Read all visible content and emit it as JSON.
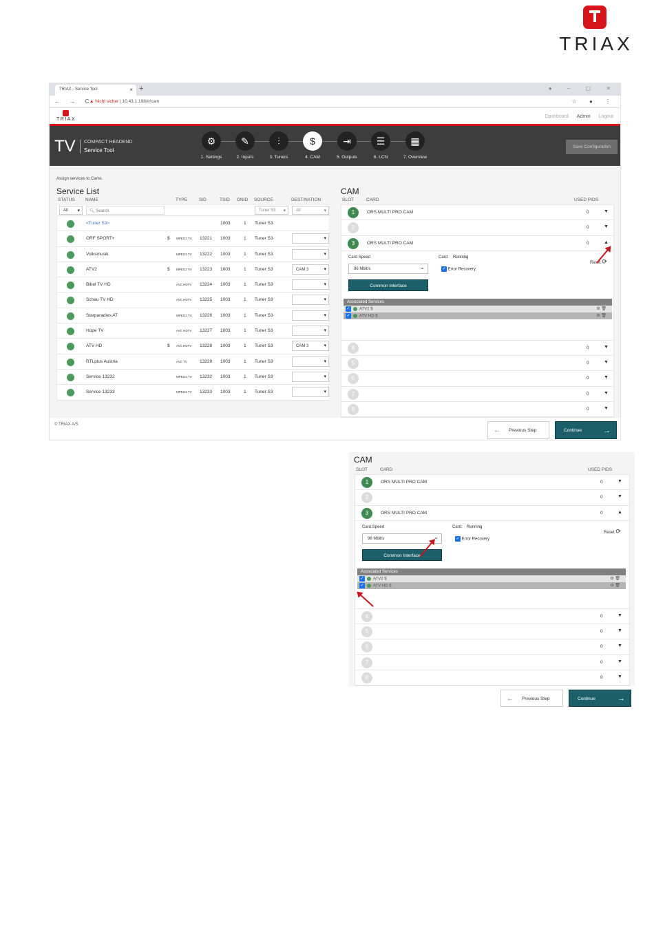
{
  "logo": {
    "word": "TRIAX"
  },
  "browser": {
    "tab_title": "TRIAX - Service Tool",
    "insecure_label": "Nicht sicher",
    "url": "10.43.1.198/#/cam"
  },
  "app": {
    "logo_word": "TRIAX",
    "nav": {
      "dashboard": "Dashboard",
      "admin": "Admin",
      "logout": "Logout"
    },
    "tv": "TV",
    "subtitle1": "COMPACT HEADEND",
    "subtitle2": "Service Tool",
    "steps": [
      {
        "label": "1. Settings",
        "icon": "gear-icon"
      },
      {
        "label": "2. Inputs",
        "icon": "plug-icon"
      },
      {
        "label": "3. Tuners",
        "icon": "sliders-icon"
      },
      {
        "label": "4. CAM",
        "icon": "cam-card-icon"
      },
      {
        "label": "5. Outputs",
        "icon": "output-icon"
      },
      {
        "label": "6. LCN",
        "icon": "list-icon"
      },
      {
        "label": "7. Overview",
        "icon": "grid-icon"
      }
    ],
    "save_config": "Save Configuration",
    "assign_text": "Assign services to Cams.",
    "service_list": {
      "title": "Service List",
      "headers": {
        "status": "STATUS",
        "name": "NAME",
        "type": "TYPE",
        "sid": "SID",
        "tsid": "TSID",
        "onid": "ONID",
        "source": "SOURCE",
        "destination": "DESTINATION"
      },
      "filter": {
        "status": "All",
        "search_placeholder": "Search",
        "source": "Tuner S3",
        "destination": "All"
      },
      "rows": [
        {
          "name": "<Tuner S3>",
          "dollar": "",
          "type": "",
          "sid": "",
          "tsid": "1003",
          "onid": "1",
          "source": "Tuner S3",
          "dest": null
        },
        {
          "name": "ORF SPORT+",
          "dollar": "$",
          "type": "MPEG2 TV",
          "sid": "13221",
          "tsid": "1003",
          "onid": "1",
          "source": "Tuner S3",
          "dest": ""
        },
        {
          "name": "Volksmusik",
          "dollar": "",
          "type": "MPEG2 TV",
          "sid": "13222",
          "tsid": "1003",
          "onid": "1",
          "source": "Tuner S3",
          "dest": ""
        },
        {
          "name": "ATV2",
          "dollar": "$",
          "type": "MPEG2 TV",
          "sid": "13223",
          "tsid": "1003",
          "onid": "1",
          "source": "Tuner S3",
          "dest": "CAM 3"
        },
        {
          "name": "Bibel TV HD",
          "dollar": "",
          "type": "AVC HDTV",
          "sid": "13224",
          "tsid": "1003",
          "onid": "1",
          "source": "Tuner S3",
          "dest": ""
        },
        {
          "name": "Schau TV HD",
          "dollar": "",
          "type": "AVC HDTV",
          "sid": "13225",
          "tsid": "1003",
          "onid": "1",
          "source": "Tuner S3",
          "dest": ""
        },
        {
          "name": "Starparadies AT",
          "dollar": "",
          "type": "MPEG2 TV",
          "sid": "13226",
          "tsid": "1003",
          "onid": "1",
          "source": "Tuner S3",
          "dest": ""
        },
        {
          "name": "Hope TV",
          "dollar": "",
          "type": "AVC HDTV",
          "sid": "13227",
          "tsid": "1003",
          "onid": "1",
          "source": "Tuner S3",
          "dest": ""
        },
        {
          "name": "ATV HD",
          "dollar": "$",
          "type": "AVC HDTV",
          "sid": "13228",
          "tsid": "1003",
          "onid": "1",
          "source": "Tuner S3",
          "dest": "CAM 3"
        },
        {
          "name": "RTLplus Austria",
          "dollar": "",
          "type": "AVC TV",
          "sid": "13229",
          "tsid": "1003",
          "onid": "1",
          "source": "Tuner S3",
          "dest": ""
        },
        {
          "name": "Service 13232",
          "dollar": "",
          "type": "MPEG2 TV",
          "sid": "13232",
          "tsid": "1003",
          "onid": "1",
          "source": "Tuner S3",
          "dest": ""
        },
        {
          "name": "Service 13233",
          "dollar": "",
          "type": "MPEG2 TV",
          "sid": "13233",
          "tsid": "1003",
          "onid": "1",
          "source": "Tuner S3",
          "dest": ""
        }
      ]
    },
    "cam": {
      "title": "CAM",
      "headers": {
        "slot": "SLOT",
        "card": "CARD",
        "used_pids": "USED PIDS"
      },
      "slots": [
        {
          "num": "1",
          "card": "ORS MULTI PRO CAM",
          "pids": "0",
          "active": true
        },
        {
          "num": "2",
          "card": "",
          "pids": "0",
          "active": false
        },
        {
          "num": "3",
          "card": "ORS MULTI PRO CAM",
          "pids": "0",
          "active": true
        },
        {
          "num": "4",
          "card": "",
          "pids": "0",
          "active": false
        },
        {
          "num": "5",
          "card": "",
          "pids": "0",
          "active": false
        },
        {
          "num": "6",
          "card": "",
          "pids": "0",
          "active": false
        },
        {
          "num": "7",
          "card": "",
          "pids": "0",
          "active": false
        },
        {
          "num": "8",
          "card": "",
          "pids": "0",
          "active": false
        }
      ],
      "expanded": {
        "card_speed_label": "Card Speed",
        "card_label": "Card:",
        "card_status": "Running",
        "reset": "Reset",
        "speed_value": "96 Mbit/s",
        "error_recovery": "Error Recovery",
        "common_interface": "Common Interface",
        "associated_header": "Associated Services",
        "associated": [
          "ATV2 $",
          "ATV HD $"
        ]
      }
    },
    "footer": {
      "copyright": "© TRIAX A/S",
      "previous": "Previous Step",
      "continue": "Continue"
    }
  }
}
